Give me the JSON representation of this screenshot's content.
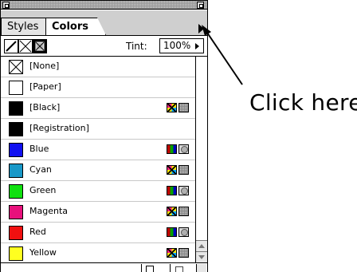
{
  "palette": {
    "tabs": [
      {
        "label": "Styles",
        "active": false
      },
      {
        "label": "Colors",
        "active": true
      }
    ],
    "toolbar": {
      "tint_label": "Tint:",
      "tint_value": "100%"
    },
    "colors": [
      {
        "label": "[None]",
        "swatch": "none",
        "type": ""
      },
      {
        "label": "[Paper]",
        "swatch": "#ffffff",
        "type": ""
      },
      {
        "label": "[Black]",
        "swatch": "#000000",
        "type": "process"
      },
      {
        "label": "[Registration]",
        "swatch": "#000000",
        "type": ""
      },
      {
        "label": "Blue",
        "swatch": "#1010f0",
        "type": "spot"
      },
      {
        "label": "Cyan",
        "swatch": "#1898c8",
        "type": "process"
      },
      {
        "label": "Green",
        "swatch": "#10e010",
        "type": "spot"
      },
      {
        "label": "Magenta",
        "swatch": "#e8107c",
        "type": "process"
      },
      {
        "label": "Red",
        "swatch": "#f01010",
        "type": "spot"
      },
      {
        "label": "Yellow",
        "swatch": "#ffff20",
        "type": "process"
      }
    ]
  },
  "annotation": {
    "text": "Click here"
  }
}
